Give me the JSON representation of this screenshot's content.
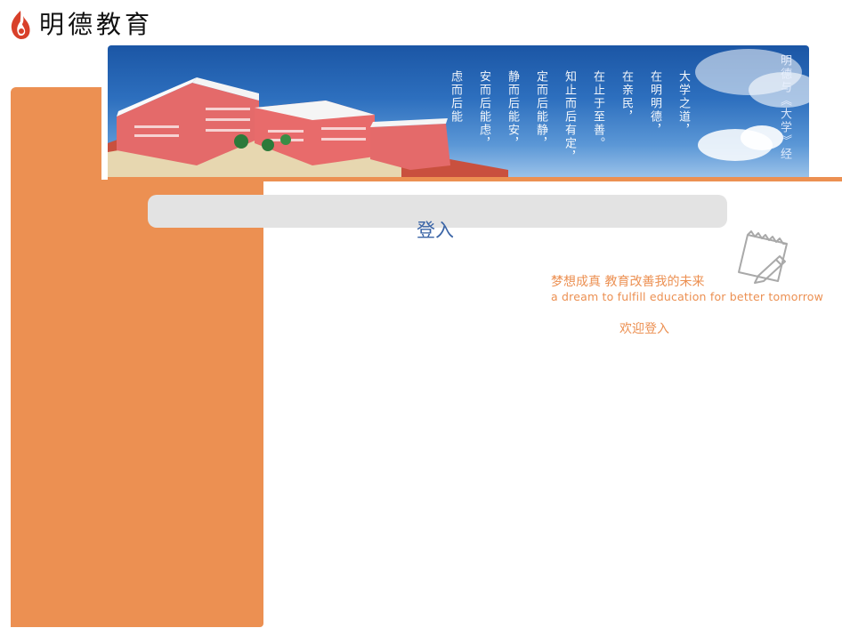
{
  "brand": {
    "name": "明德教育"
  },
  "banner": {
    "poem_columns": [
      "大学之道，",
      "在明明德，",
      "在亲民，",
      "在止于至善。",
      "知止而后有定，",
      "定而后能静，",
      "静而后能安，",
      "安而后能虑，",
      "虑而后能"
    ],
    "side_title": "明德与《大学》经"
  },
  "login": {
    "title": "登入"
  },
  "slogan": {
    "cn": "梦想成真 教育改善我的未来",
    "en": "a dream to fulfill education for better tomorrow"
  },
  "welcome": "欢迎登入",
  "colors": {
    "accent": "#ec9052",
    "sky": "#2d6fbe",
    "login_title": "#3a64a6",
    "bar": "#e3e3e3"
  }
}
